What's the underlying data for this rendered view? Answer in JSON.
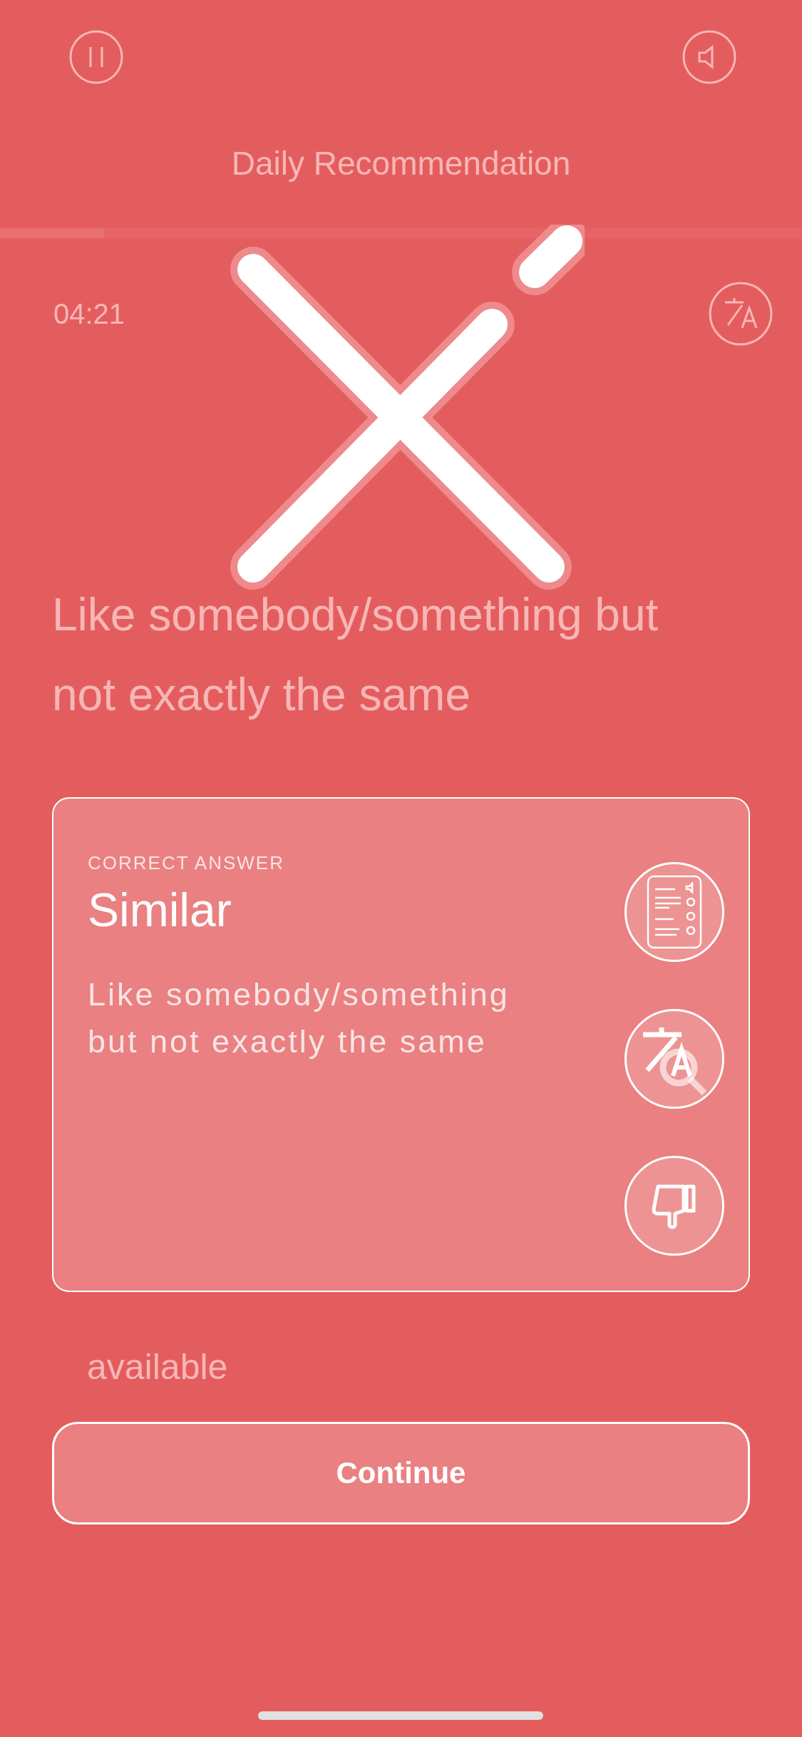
{
  "quiz": {
    "title": "Daily Recommendation",
    "progress": {
      "level": 0.13
    },
    "timer": "04:21",
    "question": "Like somebody/something but not exactly the same",
    "options": [
      {
        "label": "available"
      }
    ]
  },
  "result": {
    "correct": false,
    "label": "CORRECT ANSWER",
    "answer": "Similar",
    "definition": "Like somebody/something but not exactly the same"
  },
  "continue_button": "Continue"
}
